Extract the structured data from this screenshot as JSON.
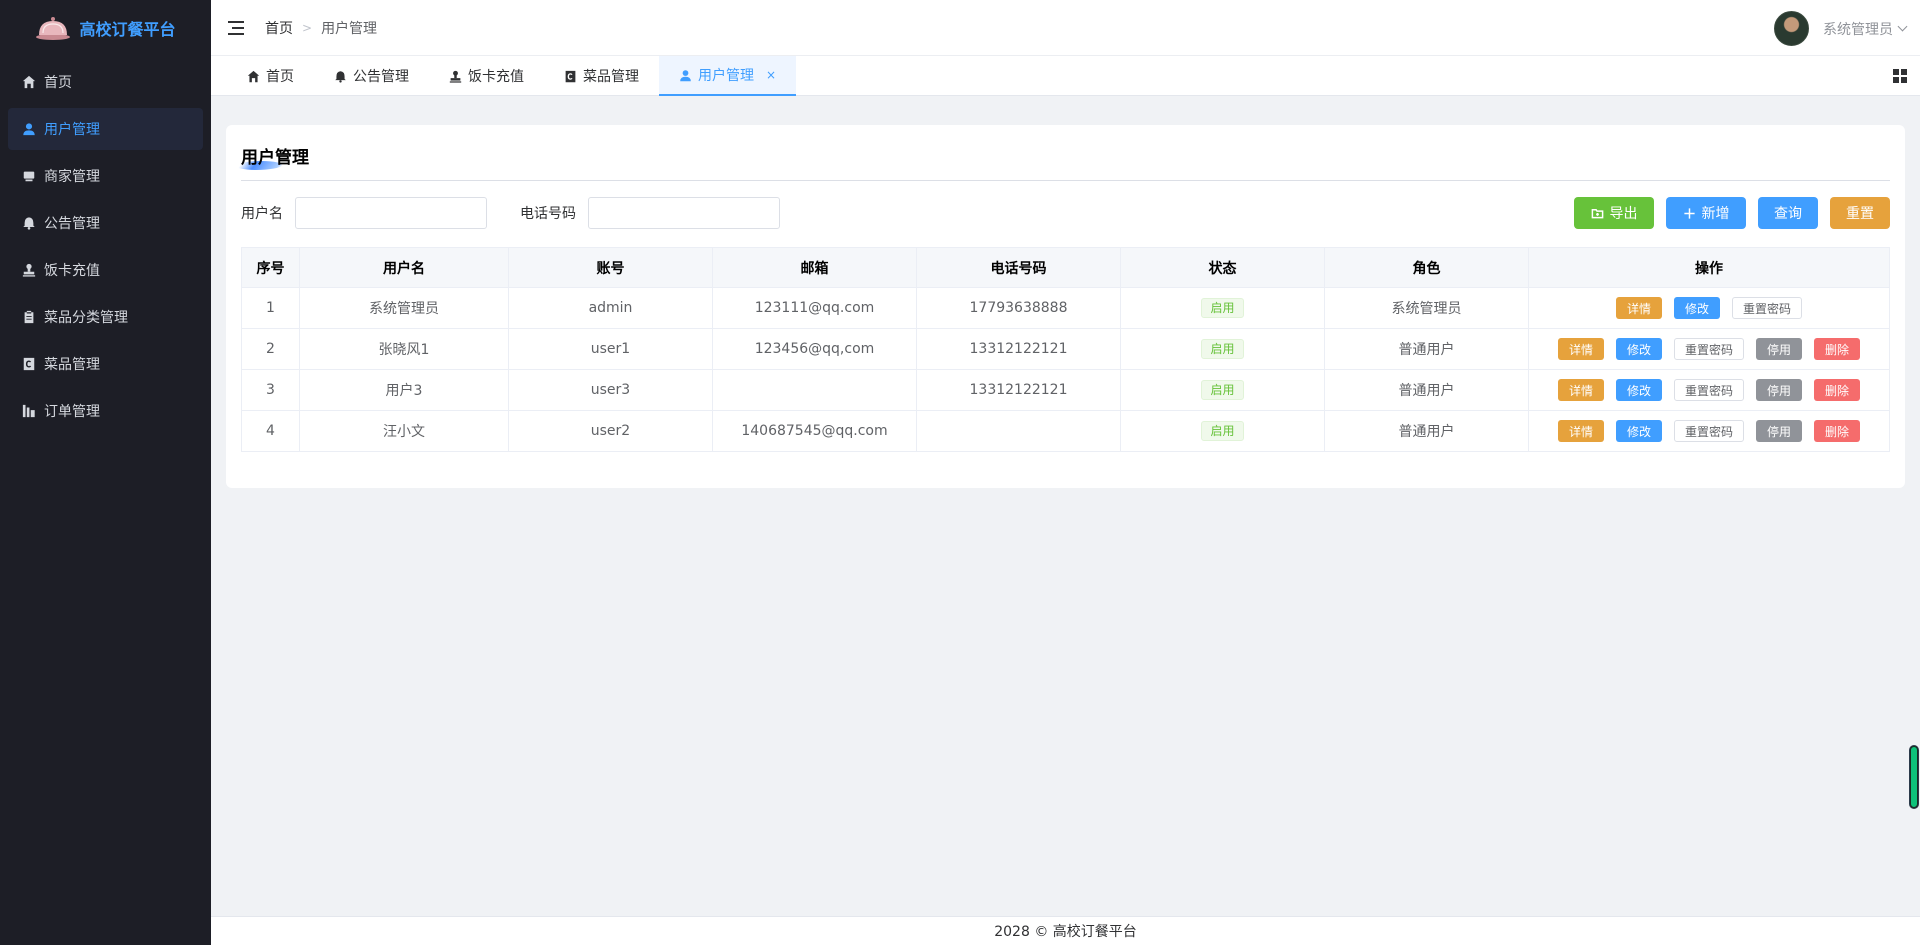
{
  "app": {
    "title": "高校订餐平台"
  },
  "sidebar": {
    "items": [
      {
        "label": "首页",
        "icon": "home-icon",
        "active": false
      },
      {
        "label": "用户管理",
        "icon": "user-icon",
        "active": true
      },
      {
        "label": "商家管理",
        "icon": "shop-icon",
        "active": false
      },
      {
        "label": "公告管理",
        "icon": "bell-icon",
        "active": false
      },
      {
        "label": "饭卡充值",
        "icon": "stamp-icon",
        "active": false
      },
      {
        "label": "菜品分类管理",
        "icon": "clipboard-icon",
        "active": false
      },
      {
        "label": "菜品管理",
        "icon": "copyright-icon",
        "active": false
      },
      {
        "label": "订单管理",
        "icon": "chart-icon",
        "active": false
      }
    ]
  },
  "header": {
    "breadcrumb": {
      "home": "首页",
      "separator": ">",
      "current": "用户管理"
    },
    "user": {
      "name": "系统管理员"
    }
  },
  "tabs": [
    {
      "label": "首页",
      "icon": "home-icon"
    },
    {
      "label": "公告管理",
      "icon": "bell-icon"
    },
    {
      "label": "饭卡充值",
      "icon": "stamp-icon"
    },
    {
      "label": "菜品管理",
      "icon": "copyright-icon"
    },
    {
      "label": "用户管理",
      "icon": "user-icon",
      "active": true,
      "close": "×"
    }
  ],
  "page": {
    "title": "用户管理",
    "search": {
      "username_label": "用户名",
      "username_value": "",
      "phone_label": "电话号码",
      "phone_value": ""
    },
    "buttons": {
      "export": "导出",
      "add": "新增",
      "query": "查询",
      "reset": "重置"
    }
  },
  "table": {
    "headers": [
      "序号",
      "用户名",
      "账号",
      "邮箱",
      "电话号码",
      "状态",
      "角色",
      "操作"
    ],
    "rows": [
      {
        "index": "1",
        "username": "系统管理员",
        "account": "admin",
        "email": "123111@qq.com",
        "phone": "17793638888",
        "status": "启用",
        "role": "系统管理员"
      },
      {
        "index": "2",
        "username": "张晓风1",
        "account": "user1",
        "email": "123456@qq,com",
        "phone": "13312122121",
        "status": "启用",
        "role": "普通用户"
      },
      {
        "index": "3",
        "username": "用户3",
        "account": "user3",
        "email": "",
        "phone": "13312122121",
        "status": "启用",
        "role": "普通用户"
      },
      {
        "index": "4",
        "username": "汪小文",
        "account": "user2",
        "email": "140687545@qq.com",
        "phone": "",
        "status": "启用",
        "role": "普通用户"
      }
    ],
    "actions": {
      "detail": "详情",
      "edit": "修改",
      "reset_password": "重置密码",
      "disable": "停用",
      "delete": "删除"
    }
  },
  "footer": {
    "text": "2028 © 高校订餐平台"
  },
  "colors": {
    "sidebar_bg": "#1d1e26",
    "accent": "#409eff",
    "success": "#67c23a",
    "warning": "#e6a23c",
    "danger": "#f56c6c",
    "info": "#909399"
  }
}
